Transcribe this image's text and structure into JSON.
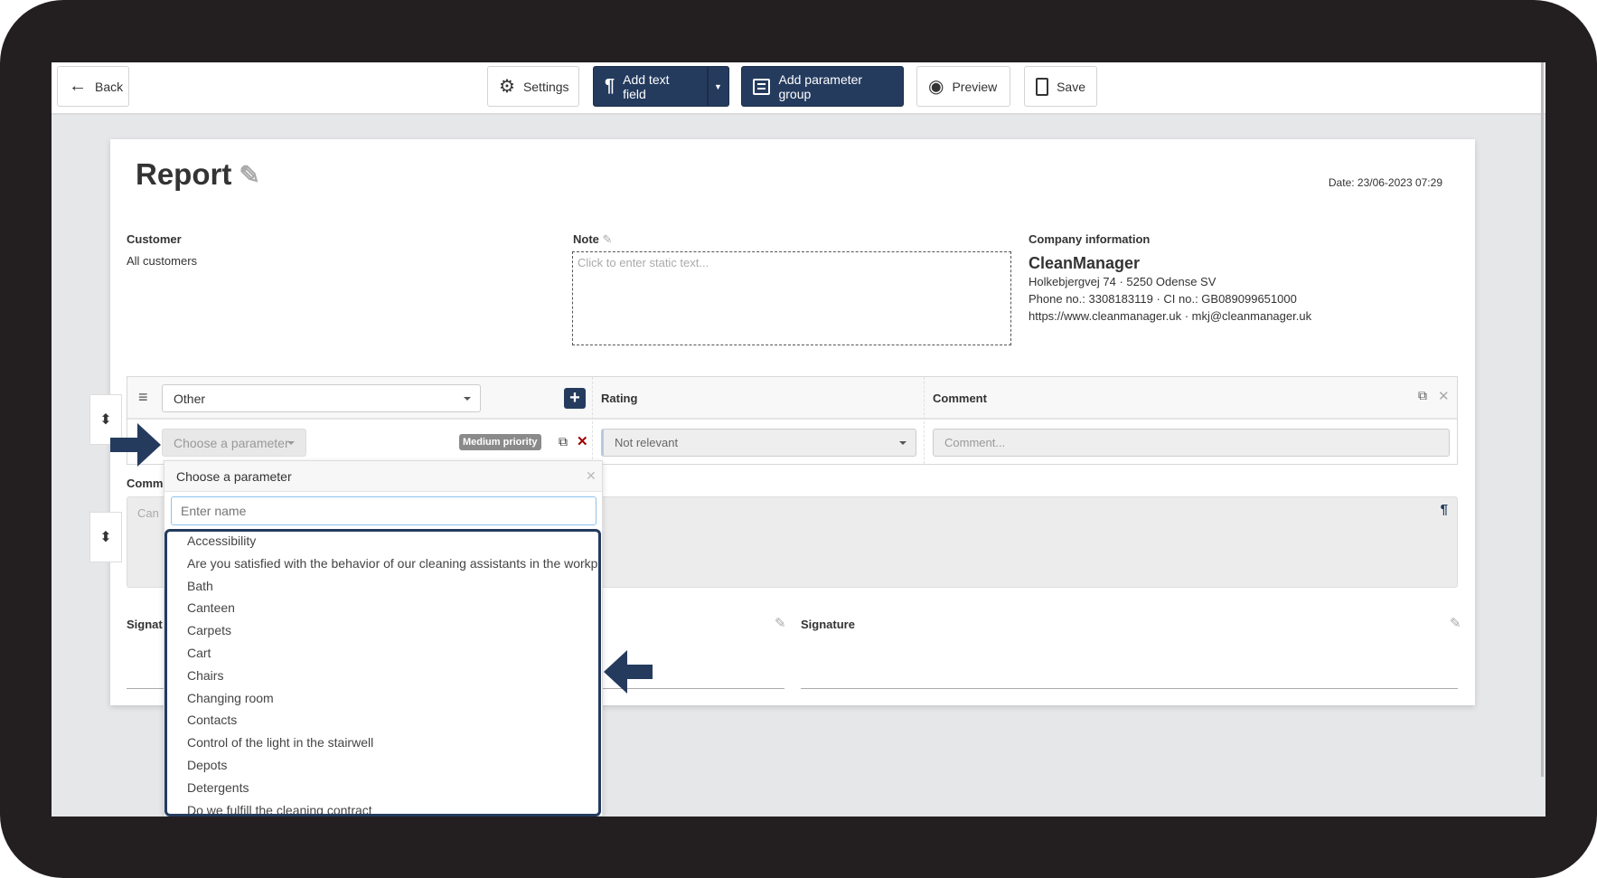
{
  "toolbar": {
    "back": "Back",
    "settings": "Settings",
    "add_text_field": "Add text field",
    "add_parameter_group": "Add parameter group",
    "preview": "Preview",
    "save": "Save"
  },
  "report": {
    "title": "Report",
    "date": "Date: 23/06-2023 07:29",
    "customer_label": "Customer",
    "customer_value": "All customers",
    "note_label": "Note",
    "note_placeholder": "Click to enter static text...",
    "company_label": "Company information",
    "company_name": "CleanManager",
    "company_address": "Holkebjergvej 74 · 5250 Odense SV",
    "company_phone": "Phone no.: 3308183119 · CI no.: GB089099651000",
    "company_web": "https://www.cleanmanager.uk · mkj@cleanmanager.uk"
  },
  "table": {
    "group_select": "Other",
    "rating_header": "Rating",
    "comment_header": "Comment",
    "parameter_button": "Choose a parameter",
    "priority_badge": "Medium priority",
    "rating_value": "Not relevant",
    "comment_placeholder": "Comment..."
  },
  "comments": {
    "label": "Comm",
    "placeholder": "Can"
  },
  "signatures": {
    "left": "Signat",
    "right": "Signature"
  },
  "dropdown": {
    "title": "Choose a parameter",
    "search_placeholder": "Enter name",
    "items": [
      "Accessibility",
      "Are you satisfied with the behavior of our cleaning assistants in the workplace",
      "Bath",
      "Canteen",
      "Carpets",
      "Cart",
      "Chairs",
      "Changing room",
      "Contacts",
      "Control of the light in the stairwell",
      "Depots",
      "Detergents",
      "Do we fulfill the cleaning contract"
    ]
  },
  "colors": {
    "navy": "#243b5e",
    "frame": "#231f20",
    "delete": "#a00000",
    "badge": "#8a8a8a"
  }
}
